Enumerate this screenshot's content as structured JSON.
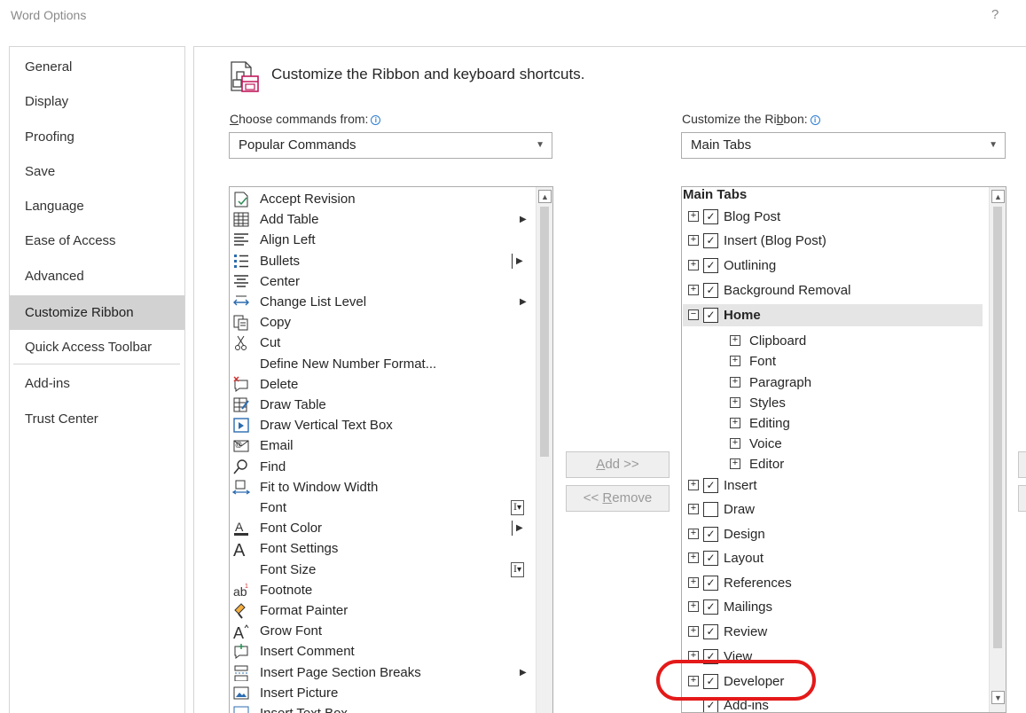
{
  "window": {
    "title": "Word Options",
    "help": "?"
  },
  "nav": [
    {
      "label": "General",
      "active": false
    },
    {
      "label": "Display",
      "active": false
    },
    {
      "label": "Proofing",
      "active": false
    },
    {
      "label": "Save",
      "active": false
    },
    {
      "label": "Language",
      "active": false
    },
    {
      "label": "Ease of Access",
      "active": false
    },
    {
      "label": "Advanced",
      "active": false
    },
    {
      "label": "Customize Ribbon",
      "active": true
    },
    {
      "label": "Quick Access Toolbar",
      "active": false
    },
    {
      "label": "Add-ins",
      "active": false
    },
    {
      "label": "Trust Center",
      "active": false
    }
  ],
  "main": {
    "heading": "Customize the Ribbon and keyboard shortcuts.",
    "choose_label_pre": "",
    "choose_label_u": "C",
    "choose_label_post": "hoose commands from:",
    "choose_value": "Popular Commands",
    "ribbon_label_pre": "Customize the Ri",
    "ribbon_label_u": "b",
    "ribbon_label_post": "bon:",
    "ribbon_value": "Main Tabs",
    "add_pre": "",
    "add_u": "A",
    "add_post": "dd >>",
    "remove_pre": "<< ",
    "remove_u": "R",
    "remove_post": "emove"
  },
  "commands": [
    {
      "label": "Accept Revision",
      "icon": "accept-revision-icon",
      "extra": ""
    },
    {
      "label": "Add Table",
      "icon": "table-icon",
      "extra": "arrow"
    },
    {
      "label": "Align Left",
      "icon": "align-left-icon",
      "extra": ""
    },
    {
      "label": "Bullets",
      "icon": "bullets-icon",
      "extra": "pipe-arrow"
    },
    {
      "label": "Center",
      "icon": "align-center-icon",
      "extra": ""
    },
    {
      "label": "Change List Level",
      "icon": "list-level-icon",
      "extra": "arrow"
    },
    {
      "label": "Copy",
      "icon": "copy-icon",
      "extra": ""
    },
    {
      "label": "Cut",
      "icon": "scissors-icon",
      "extra": ""
    },
    {
      "label": "Define New Number Format...",
      "icon": "",
      "extra": ""
    },
    {
      "label": "Delete",
      "icon": "delete-comment-icon",
      "extra": ""
    },
    {
      "label": "Draw Table",
      "icon": "draw-table-icon",
      "extra": ""
    },
    {
      "label": "Draw Vertical Text Box",
      "icon": "vertical-text-box-icon",
      "extra": ""
    },
    {
      "label": "Email",
      "icon": "email-icon",
      "extra": ""
    },
    {
      "label": "Find",
      "icon": "find-icon",
      "extra": ""
    },
    {
      "label": "Fit to Window Width",
      "icon": "fit-width-icon",
      "extra": ""
    },
    {
      "label": "Font",
      "icon": "",
      "extra": "ibox"
    },
    {
      "label": "Font Color",
      "icon": "font-color-icon",
      "extra": "pipe-arrow"
    },
    {
      "label": "Font Settings",
      "icon": "font-settings-icon",
      "extra": ""
    },
    {
      "label": "Font Size",
      "icon": "",
      "extra": "ibox"
    },
    {
      "label": "Footnote",
      "icon": "footnote-icon",
      "extra": ""
    },
    {
      "label": "Format Painter",
      "icon": "format-painter-icon",
      "extra": ""
    },
    {
      "label": "Grow Font",
      "icon": "grow-font-icon",
      "extra": ""
    },
    {
      "label": "Insert Comment",
      "icon": "insert-comment-icon",
      "extra": ""
    },
    {
      "label": "Insert Page  Section Breaks",
      "icon": "page-break-icon",
      "extra": "arrow"
    },
    {
      "label": "Insert Picture",
      "icon": "insert-picture-icon",
      "extra": ""
    },
    {
      "label": "Insert Text Box",
      "icon": "text-box-icon",
      "extra": ""
    }
  ],
  "tree": {
    "header": "Main Tabs",
    "rows": [
      {
        "label": "Blog Post",
        "level": 0,
        "checked": true,
        "expand": "+"
      },
      {
        "label": "Insert (Blog Post)",
        "level": 0,
        "checked": true,
        "expand": "+"
      },
      {
        "label": "Outlining",
        "level": 0,
        "checked": true,
        "expand": "+"
      },
      {
        "label": "Background Removal",
        "level": 0,
        "checked": true,
        "expand": "+"
      },
      {
        "label": "Home",
        "level": 0,
        "checked": true,
        "expand": "-",
        "selected": true
      },
      {
        "label": "Clipboard",
        "level": 1,
        "expand": "+"
      },
      {
        "label": "Font",
        "level": 1,
        "expand": "+"
      },
      {
        "label": "Paragraph",
        "level": 1,
        "expand": "+"
      },
      {
        "label": "Styles",
        "level": 1,
        "expand": "+"
      },
      {
        "label": "Editing",
        "level": 1,
        "expand": "+"
      },
      {
        "label": "Voice",
        "level": 1,
        "expand": "+"
      },
      {
        "label": "Editor",
        "level": 1,
        "expand": "+"
      },
      {
        "label": "Insert",
        "level": 0,
        "checked": true,
        "expand": "+"
      },
      {
        "label": "Draw",
        "level": 0,
        "checked": false,
        "expand": "+"
      },
      {
        "label": "Design",
        "level": 0,
        "checked": true,
        "expand": "+"
      },
      {
        "label": "Layout",
        "level": 0,
        "checked": true,
        "expand": "+"
      },
      {
        "label": "References",
        "level": 0,
        "checked": true,
        "expand": "+"
      },
      {
        "label": "Mailings",
        "level": 0,
        "checked": true,
        "expand": "+"
      },
      {
        "label": "Review",
        "level": 0,
        "checked": true,
        "expand": "+"
      },
      {
        "label": "View",
        "level": 0,
        "checked": true,
        "expand": "+"
      },
      {
        "label": "Developer",
        "level": 0,
        "checked": true,
        "expand": "+"
      },
      {
        "label": "Add-ins",
        "level": 0,
        "checked": true,
        "expand": ""
      }
    ]
  },
  "colors": {
    "highlight": "#e41919",
    "nav_active": "#d2d2d2",
    "info": "#2b7bd0"
  }
}
